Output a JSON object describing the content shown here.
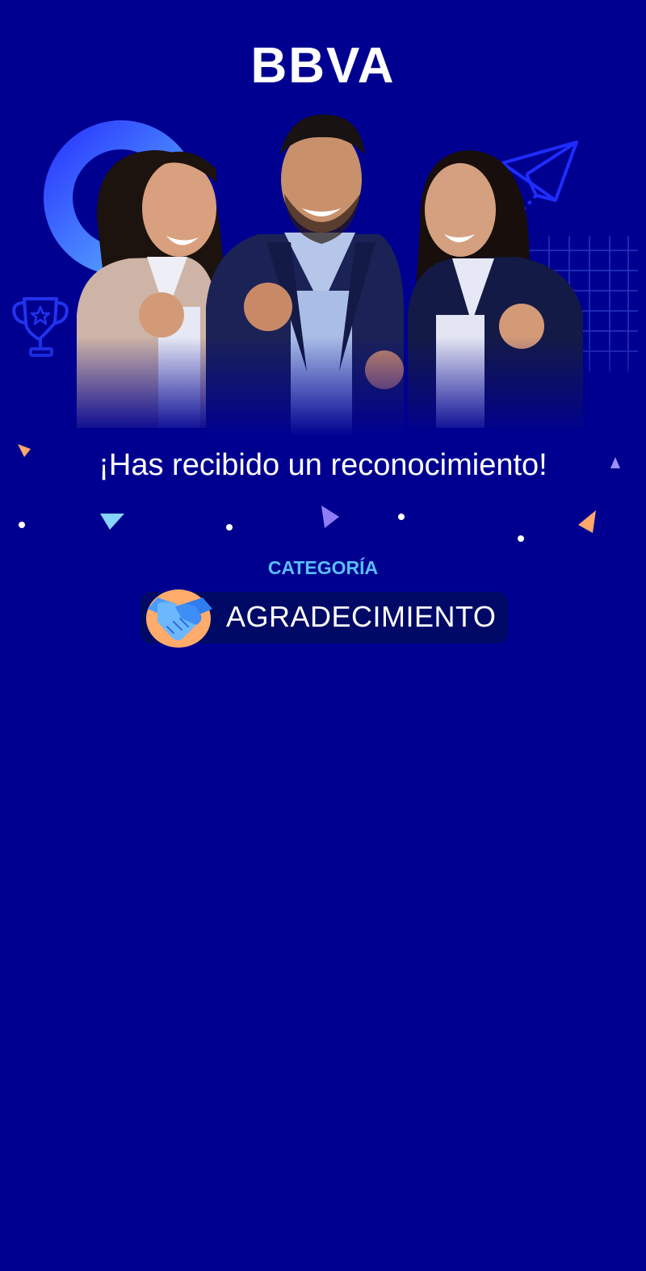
{
  "header": {
    "brand": "BBVA"
  },
  "hero": {
    "image_icon": "celebrating-team-illustration"
  },
  "message": {
    "headline": "¡Has recibido un reconocimiento!"
  },
  "category": {
    "label": "CATEGORÍA",
    "value": "AGRADECIMIENTO",
    "icon": "handshake-icon"
  },
  "colors": {
    "background": "#000090",
    "accent": "#5bbeff",
    "pill": "#000a66",
    "text": "#ffffff"
  }
}
